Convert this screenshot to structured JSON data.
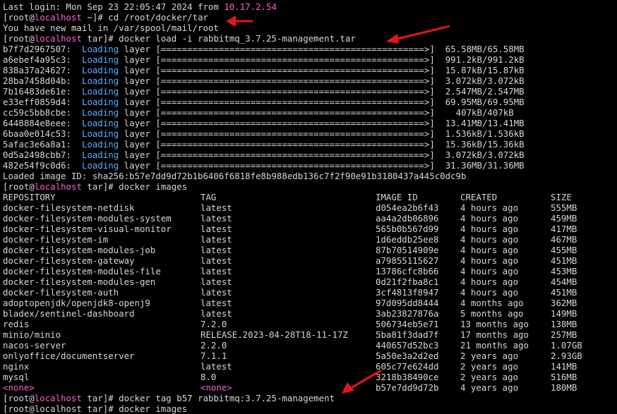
{
  "session": {
    "last_login_prefix": "Last login: Mon Sep 23 22:05:47 2024 from ",
    "last_login_ip": "10.17.2.54",
    "mail_notice": "You have new mail in /var/spool/mail/root",
    "loaded_image": "Loaded image ID: sha256:b57e7dd9d72b1b6406f6818fe8b988edb136c7f2f90e91b3180437a445c0dc9b"
  },
  "prompts": [
    {
      "user": "root",
      "host": "localhost",
      "dir": "~",
      "command": "cd /root/docker/tar"
    },
    {
      "user": "root",
      "host": "localhost",
      "dir": "tar",
      "command": "docker load -i rabbitmq_3.7.25-management.tar"
    },
    {
      "user": "root",
      "host": "localhost",
      "dir": "tar",
      "command": "docker images"
    },
    {
      "user": "root",
      "host": "localhost",
      "dir": "tar",
      "command": "docker tag b57 rabbitmq:3.7.25-management"
    }
  ],
  "layers": [
    {
      "id": "b7f7d2967507:",
      "word": "Loading",
      "rest": " layer [==================================================>]  65.58MB/65.58MB"
    },
    {
      "id": "a6ebef4a95c3:",
      "word": "Loading",
      "rest": " layer [==================================================>]  991.2kB/991.2kB"
    },
    {
      "id": "838a37a24627:",
      "word": "Loading",
      "rest": " layer [==================================================>]  15.87kB/15.87kB"
    },
    {
      "id": "28ba7458d04b:",
      "word": "Loading",
      "rest": " layer [==================================================>]  3.072kB/3.072kB"
    },
    {
      "id": "7b16483de61e:",
      "word": "Loading",
      "rest": " layer [==================================================>]  2.547MB/2.547MB"
    },
    {
      "id": "e33eff0859d4:",
      "word": "Loading",
      "rest": " layer [==================================================>]  69.95MB/69.95MB"
    },
    {
      "id": "cc59c5bb8cbe:",
      "word": "Loading",
      "rest": " layer [==================================================>]    407kB/407kB"
    },
    {
      "id": "6448884e8eee:",
      "word": "Loading",
      "rest": " layer [==================================================>]  13.41MB/13.41MB"
    },
    {
      "id": "6baa0e014c53:",
      "word": "Loading",
      "rest": " layer [==================================================>]  1.536kB/1.536kB"
    },
    {
      "id": "5afac3e6a8a1:",
      "word": "Loading",
      "rest": " layer [==================================================>]  15.36kB/15.36kB"
    },
    {
      "id": "0d5a2498cbb7:",
      "word": "Loading",
      "rest": " layer [==================================================>]  3.072kB/3.072kB"
    },
    {
      "id": "482e54f9c0d6:",
      "word": "Loading",
      "rest": " layer [==================================================>]  31.36MB/31.36MB"
    }
  ],
  "images_table": {
    "headers": [
      "REPOSITORY",
      "TAG",
      "IMAGE ID",
      "CREATED",
      "SIZE"
    ],
    "rows": [
      [
        "docker-filesystem-netdisk",
        "latest",
        "d054ea2b6f43",
        "4 hours ago",
        "555MB"
      ],
      [
        "docker-filesystem-modules-system",
        "latest",
        "aa4a2db06896",
        "4 hours ago",
        "459MB"
      ],
      [
        "docker-filesystem-visual-monitor",
        "latest",
        "565b0b567d99",
        "4 hours ago",
        "417MB"
      ],
      [
        "docker-filesystem-im",
        "latest",
        "1d6eddb25ee8",
        "4 hours ago",
        "467MB"
      ],
      [
        "docker-filesystem-modules-job",
        "latest",
        "87b70514909e",
        "4 hours ago",
        "455MB"
      ],
      [
        "docker-filesystem-gateway",
        "latest",
        "a79855115627",
        "4 hours ago",
        "451MB"
      ],
      [
        "docker-filesystem-modules-file",
        "latest",
        "13786cfc8b66",
        "4 hours ago",
        "453MB"
      ],
      [
        "docker-filesystem-modules-gen",
        "latest",
        "0d21f2fba8c1",
        "4 hours ago",
        "454MB"
      ],
      [
        "docker-filesystem-auth",
        "latest",
        "3cf4813f8947",
        "4 hours ago",
        "451MB"
      ],
      [
        "adoptopenjdk/openjdk8-openj9",
        "latest",
        "97d095dd8444",
        "4 months ago",
        "362MB"
      ],
      [
        "bladex/sentinel-dashboard",
        "latest",
        "3ab23827876a",
        "5 months ago",
        "149MB"
      ],
      [
        "redis",
        "7.2.0",
        "506734eb5e71",
        "13 months ago",
        "138MB"
      ],
      [
        "minio/minio",
        "RELEASE.2023-04-28T18-11-17Z",
        "5ba81f3dad7f",
        "17 months ago",
        "257MB"
      ],
      [
        "nacos-server",
        "2.2.0",
        "440657d52bc3",
        "21 months ago",
        "1.07GB"
      ],
      [
        "onlyoffice/documentserver",
        "7.1.1",
        "5a50e3a2d2ed",
        "2 years ago",
        "2.93GB"
      ],
      [
        "nginx",
        "latest",
        "605c77e624dd",
        "2 years ago",
        "141MB"
      ],
      [
        "mysql",
        "8.0",
        "3218b38490ce",
        "2 years ago",
        "516MB"
      ],
      [
        "<none>",
        "<none>",
        "b57e7dd9d72b",
        "4 years ago",
        "180MB"
      ]
    ]
  },
  "trailing_fragment": "[root@localhost tar]# docker images",
  "colors": {
    "background": "#000000",
    "text": "#d7d7d7",
    "highlight_magenta": "#ff5fd7",
    "loading_blue": "#5fafff",
    "annotation_red": "#e8141b"
  }
}
